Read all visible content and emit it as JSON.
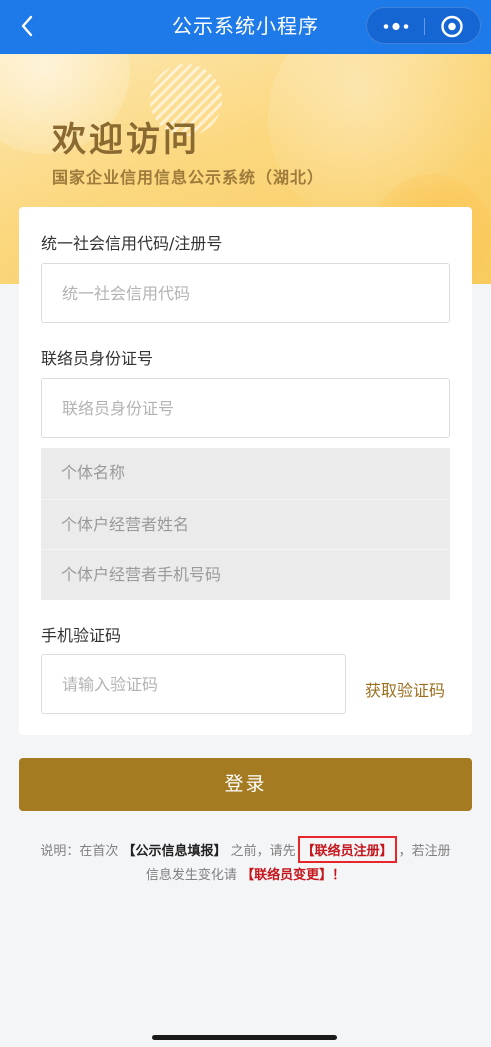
{
  "navbar": {
    "title": "公示系统小程序",
    "back_icon": "chevron-left-icon",
    "more_icon": "more-dots-icon",
    "target_icon": "target-circle-icon"
  },
  "banner": {
    "title": "欢迎访问",
    "subtitle": "国家企业信用信息公示系统（湖北）"
  },
  "form": {
    "credit_code": {
      "label": "统一社会信用代码/注册号",
      "placeholder": "统一社会信用代码"
    },
    "contact_id": {
      "label": "联络员身份证号",
      "placeholder": "联络员身份证号"
    },
    "readonly_fields": [
      "个体名称",
      "个体户经营者姓名",
      "个体户经营者手机号码"
    ],
    "sms_code": {
      "label": "手机验证码",
      "placeholder": "请输入验证码",
      "get_code_label": "获取验证码"
    },
    "login_label": "登录"
  },
  "notes": {
    "line1_prefix": "说明：在首次",
    "link_publicity": "【公示信息填报】",
    "line1_middle": "之前，请先",
    "link_register": "【联络员注册】",
    "line1_suffix": "，若注册",
    "line2_prefix": "信息发生变化请",
    "link_change": "【联络员变更】",
    "line2_suffix": "！"
  },
  "colors": {
    "nav_blue": "#1e7ae8",
    "button_gold": "#a47b21",
    "link_red": "#c4161c"
  }
}
